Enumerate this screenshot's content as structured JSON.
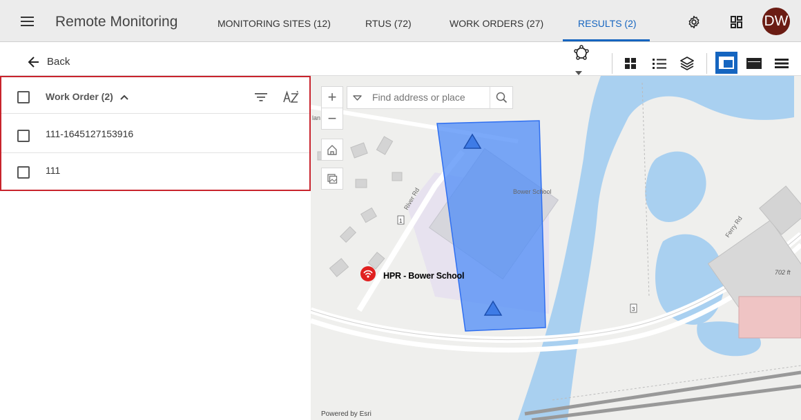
{
  "header": {
    "app_title": "Remote Monitoring",
    "tabs": [
      {
        "label": "MONITORING SITES (12)"
      },
      {
        "label": "RTUS (72)"
      },
      {
        "label": "WORK ORDERS (27)"
      },
      {
        "label": "RESULTS (2)"
      }
    ],
    "active_tab": "RESULTS (2)",
    "avatar_initials": "DW"
  },
  "toolbar": {
    "back_label": "Back"
  },
  "list": {
    "header_label": "Work Order (2)",
    "items": [
      {
        "label": "111-1645127153916"
      },
      {
        "label": "111"
      }
    ]
  },
  "map": {
    "search_placeholder": "Find address or place",
    "place_labels": {
      "school": "Bower School",
      "river_rd": "River Rd",
      "ferry_rd": "Ferry Rd",
      "elevation": "702 ft",
      "route_1": "1",
      "route_3": "3",
      "lane": "lan"
    },
    "site_marker_label": "HPR - Bower School",
    "attribution": "Powered by Esri"
  },
  "colors": {
    "accent": "#1565c0",
    "selection_border": "#c8232c",
    "avatar_bg": "#6b1c13",
    "polygon_fill": "#4f8cf7",
    "water": "#a9d0f0",
    "site_marker": "#e02020"
  }
}
